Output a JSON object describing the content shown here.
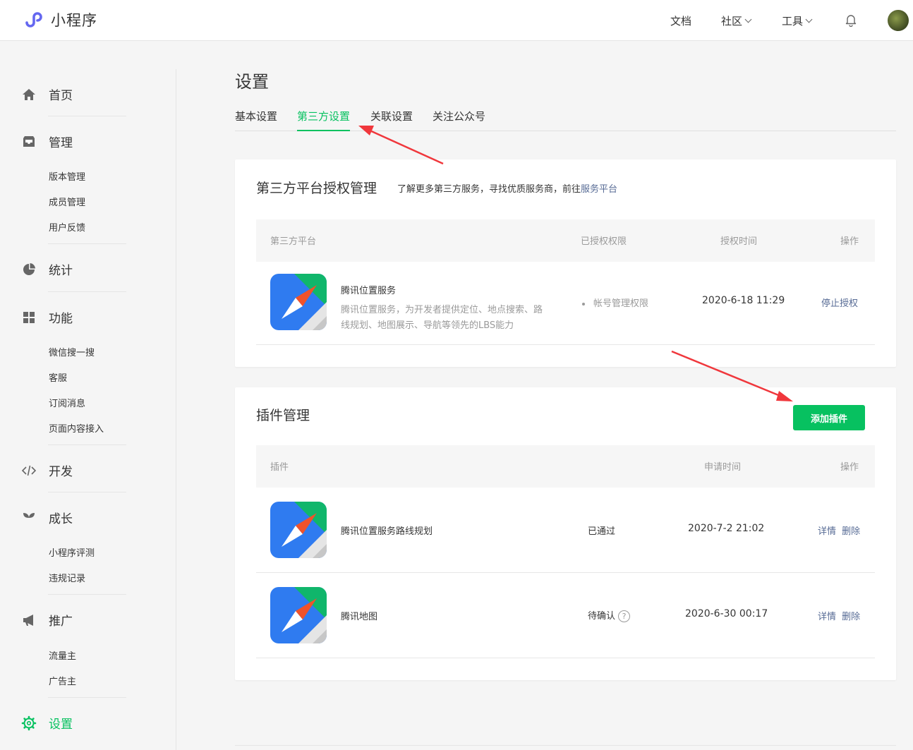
{
  "header": {
    "logo_text": "小程序",
    "nav": {
      "docs": "文档",
      "community": "社区",
      "tools": "工具"
    }
  },
  "sidebar": {
    "home": "首页",
    "manage": {
      "label": "管理",
      "items": [
        "版本管理",
        "成员管理",
        "用户反馈"
      ]
    },
    "stats": "统计",
    "features": {
      "label": "功能",
      "items": [
        "微信搜一搜",
        "客服",
        "订阅消息",
        "页面内容接入"
      ]
    },
    "develop": "开发",
    "growth": {
      "label": "成长",
      "items": [
        "小程序评测",
        "违规记录"
      ]
    },
    "promote": {
      "label": "推广",
      "items": [
        "流量主",
        "广告主"
      ]
    },
    "settings": "设置"
  },
  "page": {
    "title": "设置",
    "tabs": [
      "基本设置",
      "第三方设置",
      "关联设置",
      "关注公众号"
    ]
  },
  "third_party": {
    "title": "第三方平台授权管理",
    "desc_prefix": "了解更多第三方服务，寻找优质服务商，前往",
    "desc_link": "服务平台",
    "columns": {
      "platform": "第三方平台",
      "permission": "已授权权限",
      "time": "授权时间",
      "action": "操作"
    },
    "row": {
      "name": "腾讯位置服务",
      "desc_line1": "腾讯位置服务，为开发者提供定位、地点搜索、路",
      "desc_line2": "线规划、地图展示、导航等领先的LBS能力",
      "permission": "帐号管理权限",
      "time": "2020-6-18 11:29",
      "action": "停止授权"
    }
  },
  "plugins": {
    "title": "插件管理",
    "add_button": "添加插件",
    "columns": {
      "plugin": "插件",
      "time": "申请时间",
      "action": "操作"
    },
    "rows": [
      {
        "name": "腾讯位置服务路线规划",
        "status": "已通过",
        "time": "2020-7-2 21:02",
        "detail": "详情",
        "delete": "删除"
      },
      {
        "name": "腾讯地图",
        "status": "待确认",
        "help": "?",
        "time": "2020-6-30 00:17",
        "detail": "详情",
        "delete": "删除"
      }
    ]
  },
  "colors": {
    "accent": "#07c160",
    "link": "#576b95",
    "annotation": "#f0373c"
  }
}
